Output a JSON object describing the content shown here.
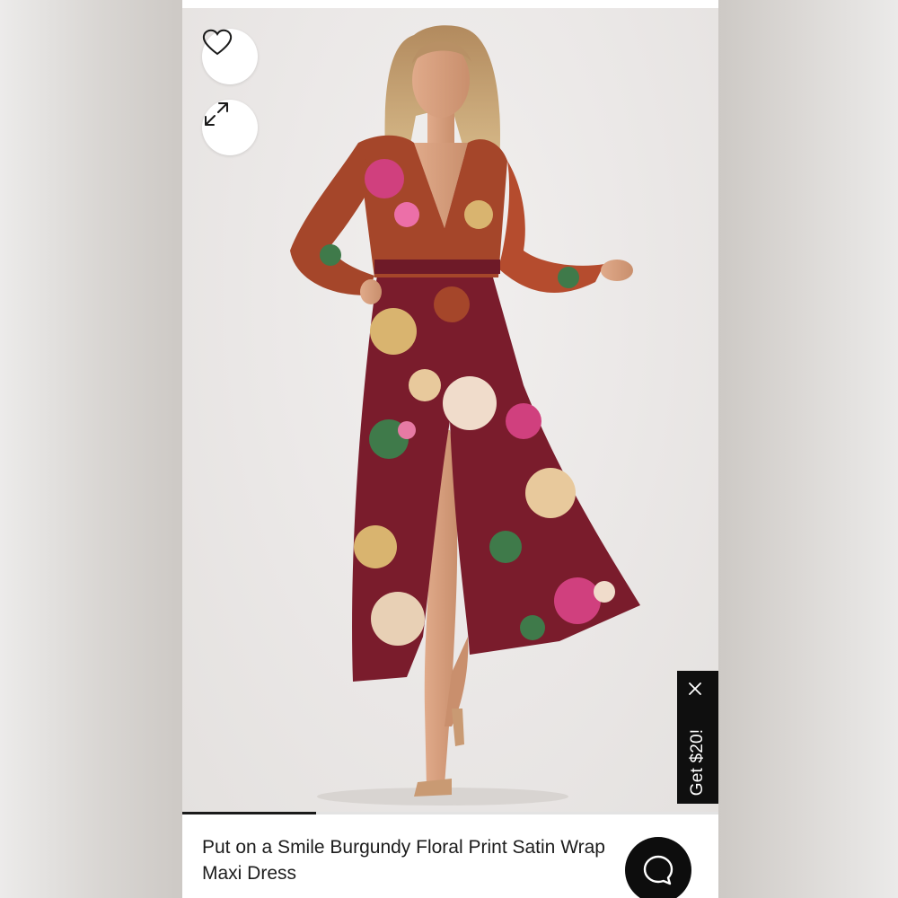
{
  "product": {
    "title": "Put on a Smile Burgundy Floral Print Satin Wrap Maxi Dress",
    "image_alt": "Model wearing a burgundy floral print satin wrap maxi dress",
    "gallery_progress_fraction": 0.25
  },
  "actions": {
    "wishlist_icon": "heart-icon",
    "expand_icon": "expand-icon",
    "chat_icon": "chat-bubble-icon"
  },
  "promo": {
    "label": "Get $20!",
    "close_icon": "close-icon"
  },
  "colors": {
    "dress_burgundy": "#7a1c2c",
    "dress_rust": "#a5462a",
    "dress_pink": "#d0407e",
    "dress_gold": "#d9b46f",
    "promo_bg": "#0f0f0f",
    "chat_bg": "#0d0d0d"
  }
}
